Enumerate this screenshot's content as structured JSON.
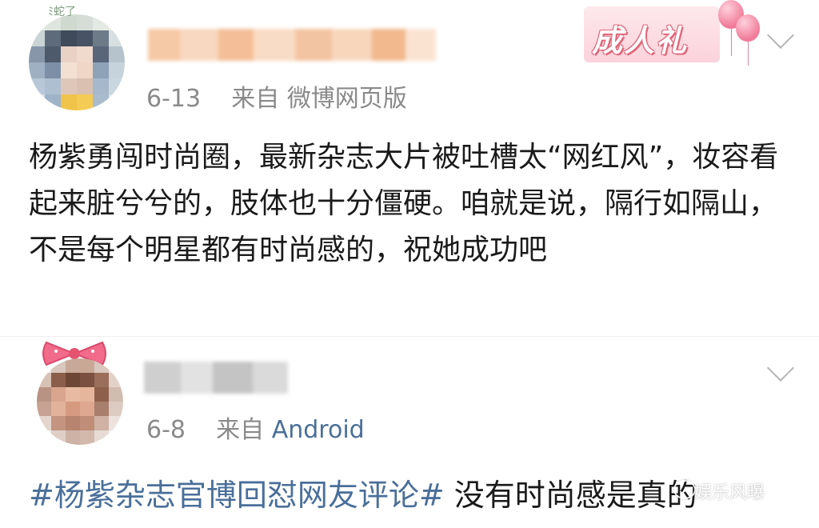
{
  "comments": [
    {
      "date": "6-13",
      "from_label": "来自",
      "source": "微博网页版",
      "badge": "成人礼",
      "avatar_deco": "ﾐ蛇了",
      "text": "杨紫勇闯时尚圈，最新杂志大片被吐槽太“网红风”，妆容看起来脏兮兮的，肢体也十分僵硬。咱就是说，隔行如隔山，不是每个明星都有时尚感的，祝她成功吧"
    },
    {
      "date": "6-8",
      "from_label": "来自",
      "source": "Android",
      "hashtag": "#杨紫杂志官博回怼网友评论#",
      "reply": " 没有时尚感是真的"
    }
  ],
  "watermark": "娱乐风曝",
  "icons": [
    "avatar-pixelated",
    "chevron-down-icon",
    "balloon-icon",
    "bow-icon",
    "wechat-icon"
  ],
  "colors": {
    "link": "#4a6f9a",
    "meta": "#8a8a8a",
    "badge": "#e0677b"
  }
}
